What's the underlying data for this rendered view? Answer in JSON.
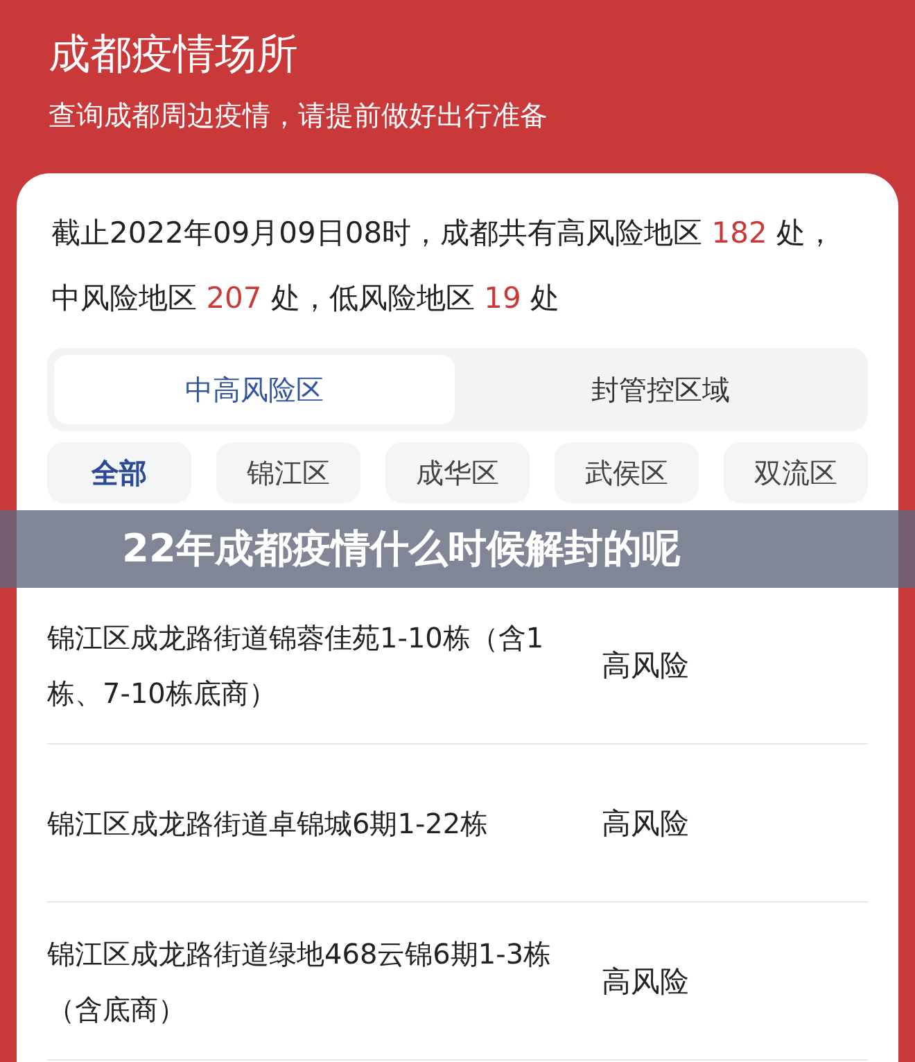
{
  "header": {
    "title": "成都疫情场所",
    "subtitle": "查询成都周边疫情，请提前做好出行准备"
  },
  "summary": [
    {
      "kind": "text",
      "text": "截止2022年09月09日08时，成都共有高风险地区 "
    },
    {
      "kind": "count",
      "text": "182"
    },
    {
      "kind": "text",
      "text": " 处，中风险地区 "
    },
    {
      "kind": "count",
      "text": "207"
    },
    {
      "kind": "text",
      "text": " 处，低风险地区 "
    },
    {
      "kind": "count",
      "text": "19"
    },
    {
      "kind": "text",
      "text": " 处"
    }
  ],
  "tabs": [
    {
      "label": "中高风险区",
      "selected": true
    },
    {
      "label": "封管控区域",
      "selected": false
    }
  ],
  "districts": [
    {
      "label": "全部",
      "selected": true
    },
    {
      "label": "锦江区",
      "selected": false
    },
    {
      "label": "成华区",
      "selected": false
    },
    {
      "label": "武侯区",
      "selected": false
    },
    {
      "label": "双流区",
      "selected": false
    }
  ],
  "banner": {
    "title": "22年成都疫情什么时候解封的呢"
  },
  "places": [
    {
      "address": "锦江区成龙路街道锦蓉佳苑1-10栋（含1栋、7-10栋底商）",
      "risk": "高风险"
    },
    {
      "address": "锦江区成龙路街道卓锦城6期1-22栋",
      "risk": "高风险"
    },
    {
      "address": "锦江区成龙路街道绿地468云锦6期1-3栋（含底商）",
      "risk": "高风险"
    }
  ]
}
